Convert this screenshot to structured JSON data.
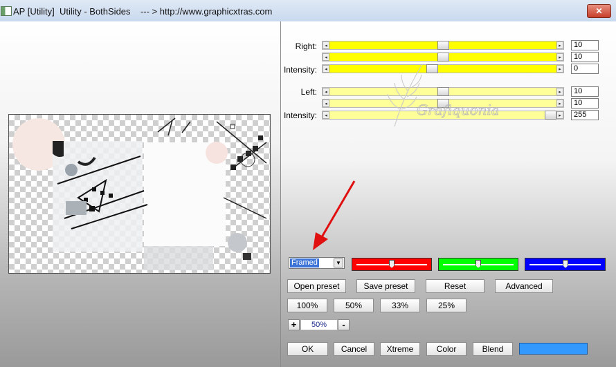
{
  "window": {
    "title": "AP [Utility]  Utility - BothSides    --- > http://www.graphicxtras.com",
    "close_label": "✕"
  },
  "watermark_text": "Grafiquonia",
  "sliders": {
    "right_label": "Right:",
    "left_label": "Left:",
    "intensity_label": "Intensity:",
    "right_1": {
      "value": "10",
      "level": 0.5
    },
    "right_2": {
      "value": "10",
      "level": 0.5
    },
    "right_intensity": {
      "value": "0",
      "level": 0.45
    },
    "left_1": {
      "value": "10",
      "level": 0.5
    },
    "left_2": {
      "value": "10",
      "level": 0.5
    },
    "left_intensity": {
      "value": "255",
      "level": 1.0
    },
    "arrow_left_glyph": "◂",
    "arrow_right_glyph": "▸"
  },
  "preset": {
    "selected": "Framed",
    "drop_glyph": "▼"
  },
  "color_sliders": [
    {
      "name": "red",
      "color": "#ff0000",
      "level": 0.5
    },
    {
      "name": "green",
      "color": "#00ff00",
      "level": 0.5
    },
    {
      "name": "blue",
      "color": "#0000ff",
      "level": 0.5
    }
  ],
  "buttons": {
    "open_preset": "Open preset",
    "save_preset": "Save preset",
    "reset": "Reset",
    "advanced": "Advanced",
    "zoom_100": "100%",
    "zoom_50": "50%",
    "zoom_33": "33%",
    "zoom_25": "25%",
    "zoom_plus": "+",
    "zoom_minus": "-",
    "ok": "OK",
    "cancel": "Cancel",
    "xtreme": "Xtreme",
    "color": "Color",
    "blend": "Blend"
  },
  "zoom_value": "50%",
  "blend_swatch_color": "#3399ff"
}
